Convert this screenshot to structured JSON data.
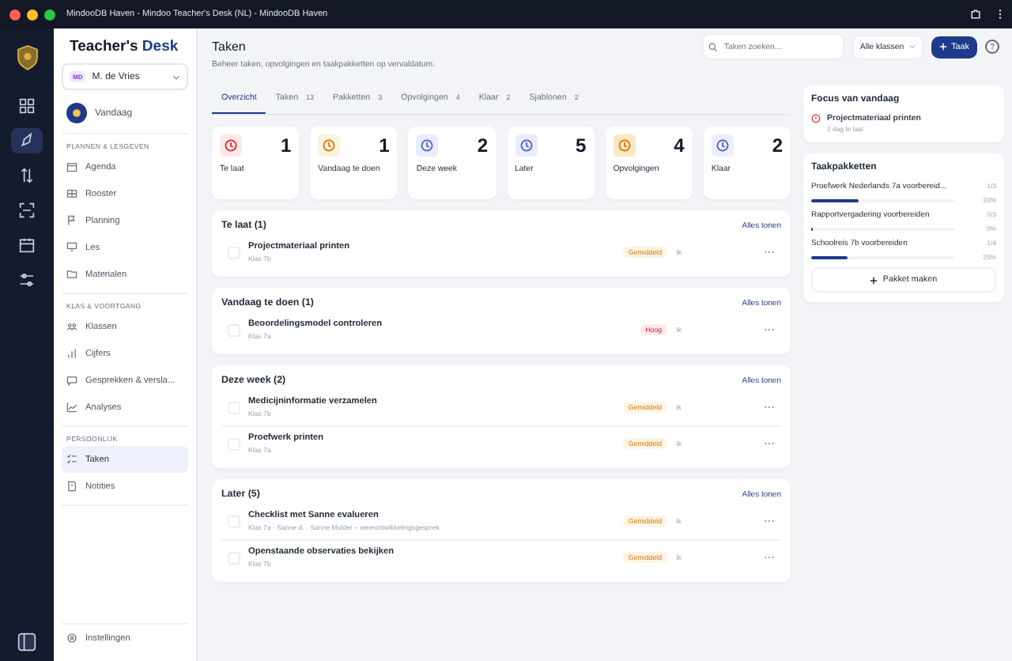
{
  "window": {
    "title": "MindooDB Haven - Mindoo Teacher's Desk (NL) - MindooDB Haven"
  },
  "rail": [
    {
      "selected": false
    },
    {
      "selected": true
    },
    {
      "selected": false
    },
    {
      "selected": false
    },
    {
      "selected": false
    },
    {
      "selected": false
    }
  ],
  "sidebar": {
    "brand": {
      "part1": "Teacher's",
      "part2": "Desk"
    },
    "user": {
      "initials": "MD",
      "name": "M. de Vries"
    },
    "today": "Vandaag",
    "sections": [
      {
        "title": "PLANNEN & LESGEVEN",
        "items": [
          {
            "label": "Agenda",
            "selected": false
          },
          {
            "label": "Rooster",
            "selected": false
          },
          {
            "label": "Planning",
            "selected": false
          },
          {
            "label": "Les",
            "selected": false
          },
          {
            "label": "Materialen",
            "selected": false
          }
        ]
      },
      {
        "title": "KLAS & VOORTGANG",
        "items": [
          {
            "label": "Klassen",
            "selected": false
          },
          {
            "label": "Cijfers",
            "selected": false
          },
          {
            "label": "Gesprekken & versla...",
            "selected": false
          },
          {
            "label": "Analyses",
            "selected": false
          }
        ]
      },
      {
        "title": "PERSOONLIJK",
        "items": [
          {
            "label": "Taken",
            "selected": true
          },
          {
            "label": "Notities",
            "selected": false
          }
        ]
      }
    ],
    "settings": "Instellingen"
  },
  "header": {
    "title": "Taken",
    "subtitle": "Beheer taken, opvolgingen en taakpakketten op vervaldatum.",
    "search_placeholder": "Taken zoeken...",
    "class_filter": "Alle klassen",
    "add_button": "Taak",
    "help": "?"
  },
  "tabs": [
    {
      "label": "Overzicht",
      "selected": true
    },
    {
      "label": "Taken",
      "count": "13",
      "selected": false
    },
    {
      "label": "Pakketten",
      "count": "3",
      "selected": false
    },
    {
      "label": "Opvolgingen",
      "count": "4",
      "selected": false
    },
    {
      "label": "Klaar",
      "count": "2",
      "selected": false
    },
    {
      "label": "Sjablonen",
      "count": "2",
      "selected": false
    }
  ],
  "stats": [
    {
      "label": "Te laat",
      "value": "1",
      "kind": "late"
    },
    {
      "label": "Vandaag te doen",
      "value": "1",
      "kind": "today"
    },
    {
      "label": "Deze week",
      "value": "2",
      "kind": "week"
    },
    {
      "label": "Later",
      "value": "5",
      "kind": "later"
    },
    {
      "label": "Opvolgingen",
      "value": "4",
      "kind": "follow"
    },
    {
      "label": "Klaar",
      "value": "2",
      "kind": "done"
    }
  ],
  "sections": [
    {
      "title": "Te laat (1)",
      "link": "Alles tonen",
      "tasks": [
        {
          "title": "Projectmateriaal printen",
          "meta": "Klas 7b",
          "priority": "Gemiddeld",
          "kind": "medium",
          "assignee": "Ik",
          "checked": false
        }
      ]
    },
    {
      "title": "Vandaag te doen (1)",
      "link": "Alles tonen",
      "tasks": [
        {
          "title": "Beoordelingsmodel controleren",
          "meta": "Klas 7a",
          "priority": "Hoog",
          "kind": "high",
          "assignee": "Ik",
          "checked": false
        }
      ]
    },
    {
      "title": "Deze week (2)",
      "link": "Alles tonen",
      "tasks": [
        {
          "title": "Medicijninformatie verzamelen",
          "meta": "Klas 7b",
          "priority": "Gemiddeld",
          "kind": "medium",
          "assignee": "Ik",
          "checked": false
        },
        {
          "title": "Proefwerk printen",
          "meta": "Klas 7a",
          "priority": "Gemiddeld",
          "kind": "medium",
          "assignee": "Ik",
          "checked": false
        }
      ]
    },
    {
      "title": "Later (5)",
      "link": "Alles tonen",
      "tasks": [
        {
          "title": "Checklist met Sanne evalueren",
          "meta": "Klas 7a · Sanne d. · Sanne Mulder – weerontwikkelingsgesprek",
          "priority": "Gemiddeld",
          "kind": "medium",
          "assignee": "Ik",
          "checked": false
        },
        {
          "title": "Openstaande observaties bekijken",
          "meta": "Klas 7b",
          "priority": "Gemiddeld",
          "kind": "medium",
          "assignee": "Ik",
          "checked": false
        }
      ]
    }
  ],
  "focus": {
    "title": "Focus van vandaag",
    "task": "Projectmateriaal printen",
    "note": "1 dag te laat"
  },
  "packages": {
    "title": "Taakpakketten",
    "items": [
      {
        "name": "Proefwerk Nederlands 7a voorbereid...",
        "count": "1/3",
        "percent": "33%",
        "level": 0.33
      },
      {
        "name": "Rapportvergadering voorbereiden",
        "count": "0/3",
        "percent": "0%",
        "level": 0
      },
      {
        "name": "Schoolreis 7b voorbereiden",
        "count": "1/4",
        "percent": "25%",
        "level": 0.25
      }
    ],
    "button": "Pakket maken"
  }
}
